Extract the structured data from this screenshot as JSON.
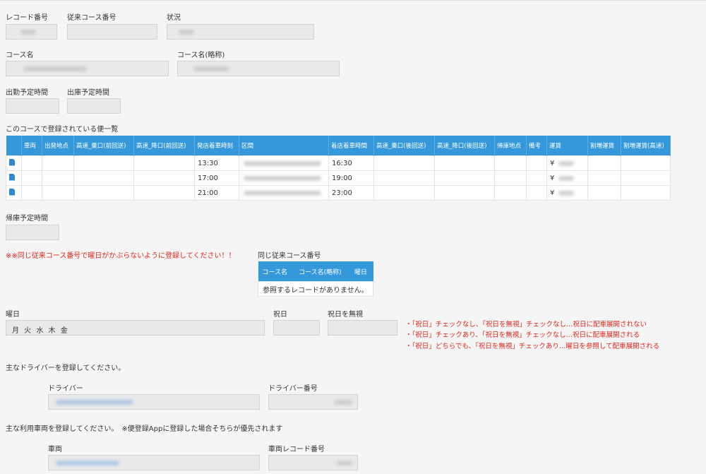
{
  "fields": {
    "record_no_label": "レコード番号",
    "legacy_course_no_label": "従来コース番号",
    "status_label": "状況",
    "course_name_label": "コース名",
    "course_short_label": "コース名(略称)",
    "start_time_label": "出勤予定時間",
    "depart_time_label": "出庫予定時間",
    "return_time_label": "帰庫予定時間"
  },
  "trips": {
    "heading": "このコースで登録されている便一覧",
    "columns": [
      "",
      "車両",
      "出発地点",
      "高速_乗口(前回送)",
      "高速_降口(前回送)",
      "発店着車時刻",
      "区間",
      "着店着車時間",
      "高速_乗口(後回送)",
      "高速_降口(後回送)",
      "帰庫地点",
      "備考",
      "運賃",
      "割増運賃",
      "割増運賃(高速)"
    ],
    "rows": [
      {
        "depart": "13:30",
        "arrive": "16:30",
        "fare_prefix": "¥"
      },
      {
        "depart": "17:00",
        "arrive": "19:00",
        "fare_prefix": "¥"
      },
      {
        "depart": "21:00",
        "arrive": "23:00",
        "fare_prefix": "¥"
      }
    ]
  },
  "warning": "※※同じ従来コース番号で曜日がかぶらないように登録してください！！",
  "same_course": {
    "label": "同じ従来コース番号",
    "columns": [
      "コース名",
      "コース名(略称)",
      "曜日"
    ],
    "empty": "参照するレコードがありません。"
  },
  "days": {
    "label": "曜日",
    "value": "月 火 水 木 金",
    "holiday_label": "祝日",
    "ignore_holiday_label": "祝日を無視"
  },
  "notes": [
    "・「祝日」チェックなし、「祝日を無視」チェックなし…祝日に配車展開されない",
    "・「祝日」チェックあり、「祝日を無視」チェックなし…祝日に配車展開される",
    "・「祝日」どちらでも、「祝日を無視」チェックあり…曜日を参照して配車展開される"
  ],
  "driver": {
    "prompt": "主なドライバーを登録してください。",
    "driver_label": "ドライバー",
    "driver_no_label": "ドライバー番号"
  },
  "vehicle": {
    "prompt": "主な利用車両を登録してください。　※便登録Appに登録した場合そちらが優先されます",
    "vehicle_label": "車両",
    "vehicle_record_label": "車両レコード番号"
  },
  "colors": {
    "header_blue": "#3498db",
    "warning_red": "#e0261c",
    "field_bg": "#e9e9e9"
  }
}
